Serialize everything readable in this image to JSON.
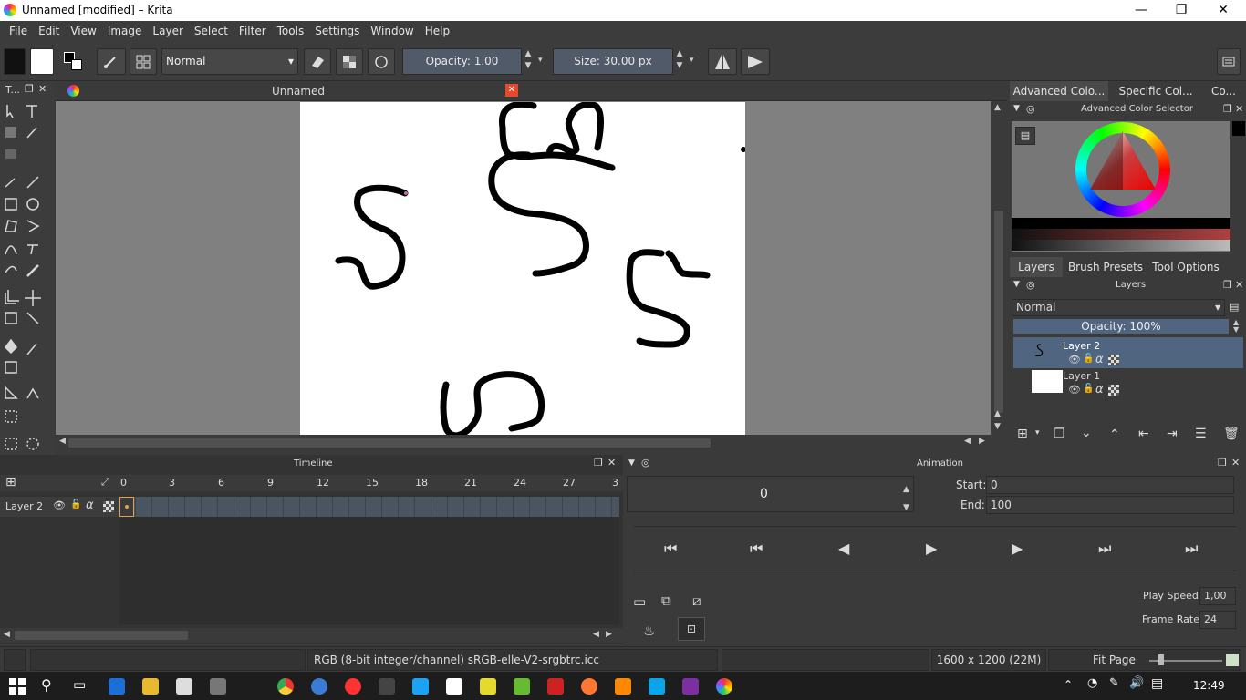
{
  "window": {
    "title": "Unnamed [modified] – Krita",
    "minimize": "—",
    "maximize": "❐",
    "close": "✕"
  },
  "menu": [
    "File",
    "Edit",
    "View",
    "Image",
    "Layer",
    "Select",
    "Filter",
    "Tools",
    "Settings",
    "Window",
    "Help"
  ],
  "toolbar": {
    "blend_mode": "Normal",
    "opacity_label": "Opacity:  1.00",
    "size_label": "Size:  30.00 px"
  },
  "toolbox": {
    "title": "T..."
  },
  "document": {
    "tab_title": "Unnamed"
  },
  "right_dock": {
    "top_tabs": [
      "Advanced Colo...",
      "Specific Col...",
      "Co..."
    ],
    "color_selector_title": "Advanced Color Selector",
    "mid_tabs": [
      "Layers",
      "Brush Presets",
      "Tool Options"
    ],
    "layers_title": "Layers",
    "blend_mode": "Normal",
    "opacity_label": "Opacity:  100%",
    "layers": [
      {
        "name": "Layer 2",
        "selected": true
      },
      {
        "name": "Layer 1",
        "selected": false
      }
    ]
  },
  "timeline": {
    "title": "Timeline",
    "ruler": [
      "0",
      "3",
      "6",
      "9",
      "12",
      "15",
      "18",
      "21",
      "24",
      "27",
      "3"
    ],
    "layer_name": "Layer 2"
  },
  "animation": {
    "title": "Animation",
    "current_frame": "0",
    "start_label": "Start:",
    "start_value": "0",
    "end_label": "End:",
    "end_value": "100",
    "play_speed_label": "Play Speed:",
    "play_speed_value": "1,00",
    "frame_rate_label": "Frame Rate:",
    "frame_rate_value": "24"
  },
  "status": {
    "color_info": "RGB (8-bit integer/channel)  sRGB-elle-V2-srgbtrc.icc",
    "dimensions": "1600 x 1200 (22M)",
    "zoom": "Fit Page"
  },
  "taskbar": {
    "time": "12:49"
  },
  "colors": {
    "accent": "#4f6580",
    "field": "#505a68",
    "panel": "#3a3a3a"
  }
}
